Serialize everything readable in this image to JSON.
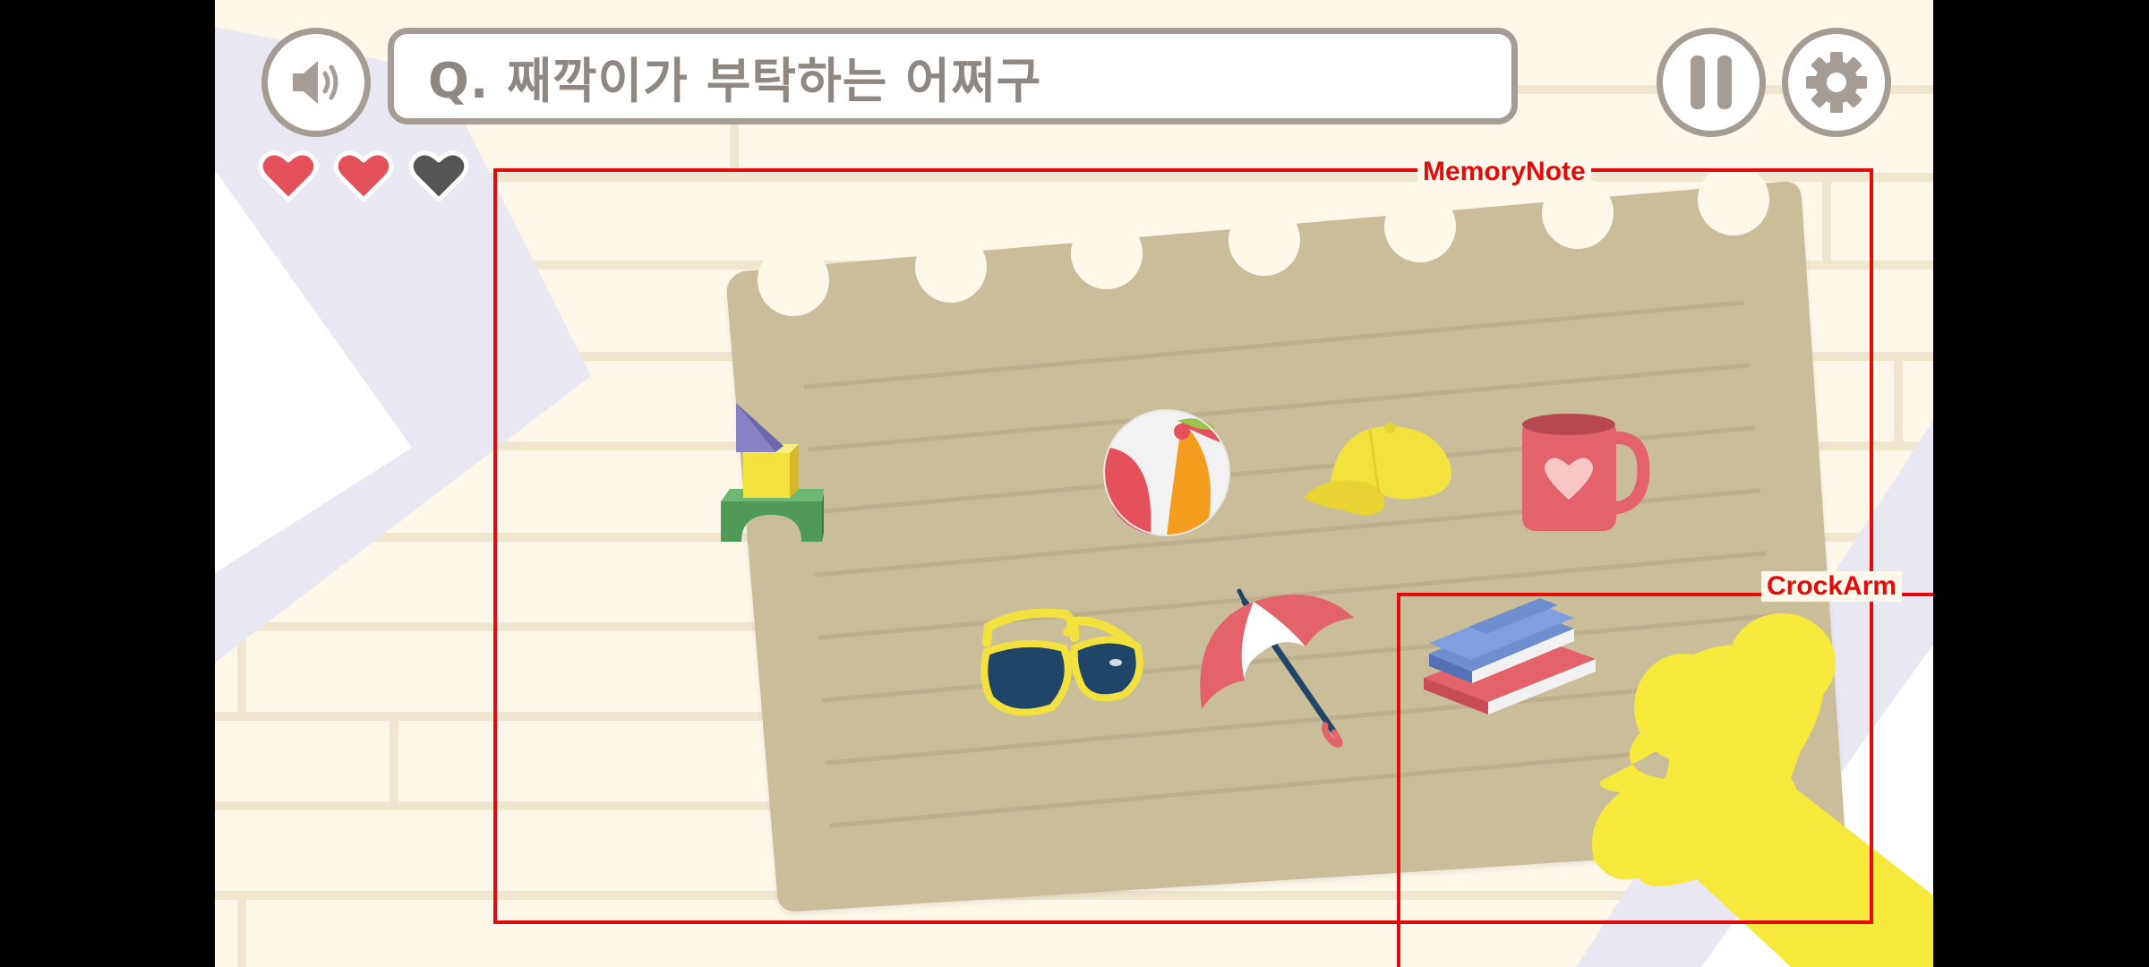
{
  "question": {
    "text": "Q. 째깍이가 부탁하는 어쩌구"
  },
  "buttons": {
    "sound": "speaker-icon",
    "pause": "pause-icon",
    "settings": "gear-icon"
  },
  "lives": {
    "total": 3,
    "remaining": 2,
    "full_color": "#e4515a",
    "empty_color": "#555555"
  },
  "items": [
    "toy-blocks-icon",
    "beach-ball-icon",
    "cap-icon",
    "mug-icon",
    "sunglasses-icon",
    "umbrella-icon",
    "books-icon"
  ],
  "debug": {
    "note_label": "MemoryNote",
    "arm_label": "CrockArm"
  },
  "colors": {
    "frame": "#a59c95",
    "paper": "#cabd9a",
    "claw": "#f7e83c",
    "debug": "#e30b0b"
  }
}
